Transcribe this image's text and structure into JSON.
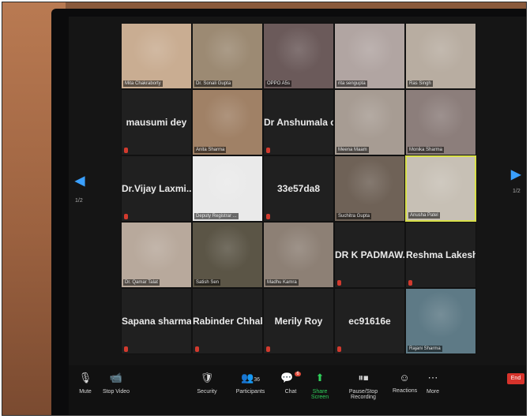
{
  "tiles": [
    {
      "name": "Mita Chakraborty",
      "text": "",
      "video": true,
      "bg": "#c9ad92"
    },
    {
      "name": "Dr. Sonali Gupta",
      "text": "",
      "video": true,
      "bg": "#9c8a73"
    },
    {
      "name": "OPPO A5s",
      "text": "",
      "video": true,
      "bg": "#6b5a5a"
    },
    {
      "name": "rita sengupta",
      "text": "",
      "video": true,
      "bg": "#b1a5a2"
    },
    {
      "name": "Ras Singh",
      "text": "",
      "video": true,
      "bg": "#b8ada1"
    },
    {
      "name": "",
      "text": "mausumi dey",
      "video": false
    },
    {
      "name": "Anita Sharma",
      "text": "",
      "video": true,
      "bg": "#a08166"
    },
    {
      "name": "",
      "text": "Dr Anshumala c...",
      "video": false
    },
    {
      "name": "Meena Maam",
      "text": "",
      "video": true,
      "bg": "#a79c93"
    },
    {
      "name": "Monika Sharma",
      "text": "",
      "video": true,
      "bg": "#8c7e7b"
    },
    {
      "name": "",
      "text": "Dr.Vijay Laxmi...",
      "video": false
    },
    {
      "name": "Deputy Registrar ...",
      "text": "",
      "video": true,
      "bg": "#eaeaea"
    },
    {
      "name": "",
      "text": "33e57da8",
      "video": false
    },
    {
      "name": "Suchitra Gupta",
      "text": "",
      "video": true,
      "bg": "#6f6257"
    },
    {
      "name": "Anusha Patel",
      "text": "",
      "video": true,
      "bg": "#c7c0b5",
      "active": true
    },
    {
      "name": "Dr. Qamar Talat",
      "text": "",
      "video": true,
      "bg": "#b8a99c"
    },
    {
      "name": "Satish Sen",
      "text": "",
      "video": true,
      "bg": "#5b5546"
    },
    {
      "name": "Madhu Kamra",
      "text": "",
      "video": true,
      "bg": "#8d8075"
    },
    {
      "name": "",
      "text": "DR K PADMAW...",
      "video": false
    },
    {
      "name": "",
      "text": "Reshma Lakesh",
      "video": false
    },
    {
      "name": "",
      "text": "Sapana sharma",
      "video": false
    },
    {
      "name": "",
      "text": "Rabinder Chhab...",
      "video": false
    },
    {
      "name": "",
      "text": "Merily Roy",
      "video": false
    },
    {
      "name": "",
      "text": "ec91616e",
      "video": false
    },
    {
      "name": "Rajani Sharma",
      "text": "",
      "video": true,
      "bg": "#5e7a86"
    }
  ],
  "page_left": "1/2",
  "page_right": "1/2",
  "toolbar": {
    "mute": "Mute",
    "stop_video": "Stop Video",
    "security": "Security",
    "participants": "Participants",
    "participants_count": "36",
    "chat": "Chat",
    "chat_badge": "6",
    "share": "Share Screen",
    "record": "Pause/Stop Recording",
    "reactions": "Reactions",
    "more": "More",
    "end": "End"
  }
}
